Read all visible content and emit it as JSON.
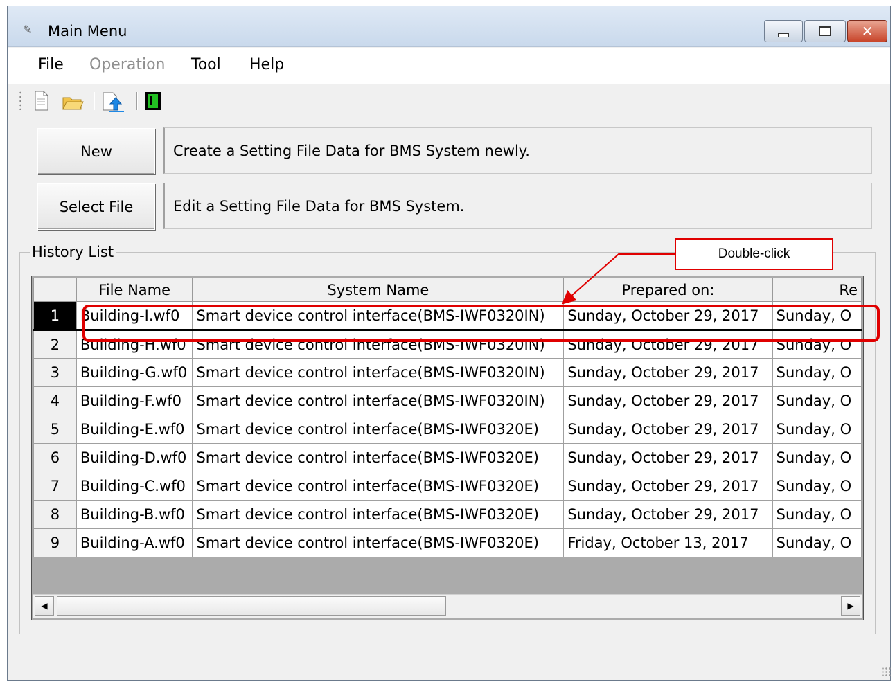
{
  "window": {
    "title": "Main Menu"
  },
  "menu": {
    "file": "File",
    "operation": "Operation",
    "tool": "Tool",
    "help": "Help"
  },
  "toolbar": [
    "new-file-icon",
    "open-folder-icon",
    "upload-icon",
    "green-terminal-icon"
  ],
  "buttons": {
    "new": "New",
    "new_desc": "Create a Setting File Data for BMS System newly.",
    "select": "Select File",
    "select_desc": "Edit a Setting File Data for BMS System."
  },
  "history": {
    "label": "History List",
    "columns": [
      "File Name",
      "System Name",
      "Prepared on:",
      "Re"
    ],
    "rows": [
      {
        "num": "1",
        "file": "Building-I.wf0",
        "system": "Smart device control interface(BMS-IWF0320IN)",
        "prepared": "Sunday, October 29, 2017",
        "re": "Sunday, O"
      },
      {
        "num": "2",
        "file": "Building-H.wf0",
        "system": "Smart device control interface(BMS-IWF0320IN)",
        "prepared": "Sunday, October 29, 2017",
        "re": "Sunday, O"
      },
      {
        "num": "3",
        "file": "Building-G.wf0",
        "system": "Smart device control interface(BMS-IWF0320IN)",
        "prepared": "Sunday, October 29, 2017",
        "re": "Sunday, O"
      },
      {
        "num": "4",
        "file": "Building-F.wf0",
        "system": "Smart device control interface(BMS-IWF0320IN)",
        "prepared": "Sunday, October 29, 2017",
        "re": "Sunday, O"
      },
      {
        "num": "5",
        "file": "Building-E.wf0",
        "system": "Smart device control interface(BMS-IWF0320E)",
        "prepared": "Sunday, October 29, 2017",
        "re": "Sunday, O"
      },
      {
        "num": "6",
        "file": "Building-D.wf0",
        "system": "Smart device control interface(BMS-IWF0320E)",
        "prepared": "Sunday, October 29, 2017",
        "re": "Sunday, O"
      },
      {
        "num": "7",
        "file": "Building-C.wf0",
        "system": "Smart device control interface(BMS-IWF0320E)",
        "prepared": "Sunday, October 29, 2017",
        "re": "Sunday, O"
      },
      {
        "num": "8",
        "file": "Building-B.wf0",
        "system": "Smart device control interface(BMS-IWF0320E)",
        "prepared": "Sunday, October 29, 2017",
        "re": "Sunday, O"
      },
      {
        "num": "9",
        "file": "Building-A.wf0",
        "system": "Smart device control interface(BMS-IWF0320E)",
        "prepared": "Friday, October 13, 2017",
        "re": "Sunday, O"
      }
    ],
    "selected_row": 1
  },
  "annotation": {
    "callout": "Double-click"
  },
  "colors": {
    "accent": "#e00000",
    "selected_header": "#000000"
  }
}
